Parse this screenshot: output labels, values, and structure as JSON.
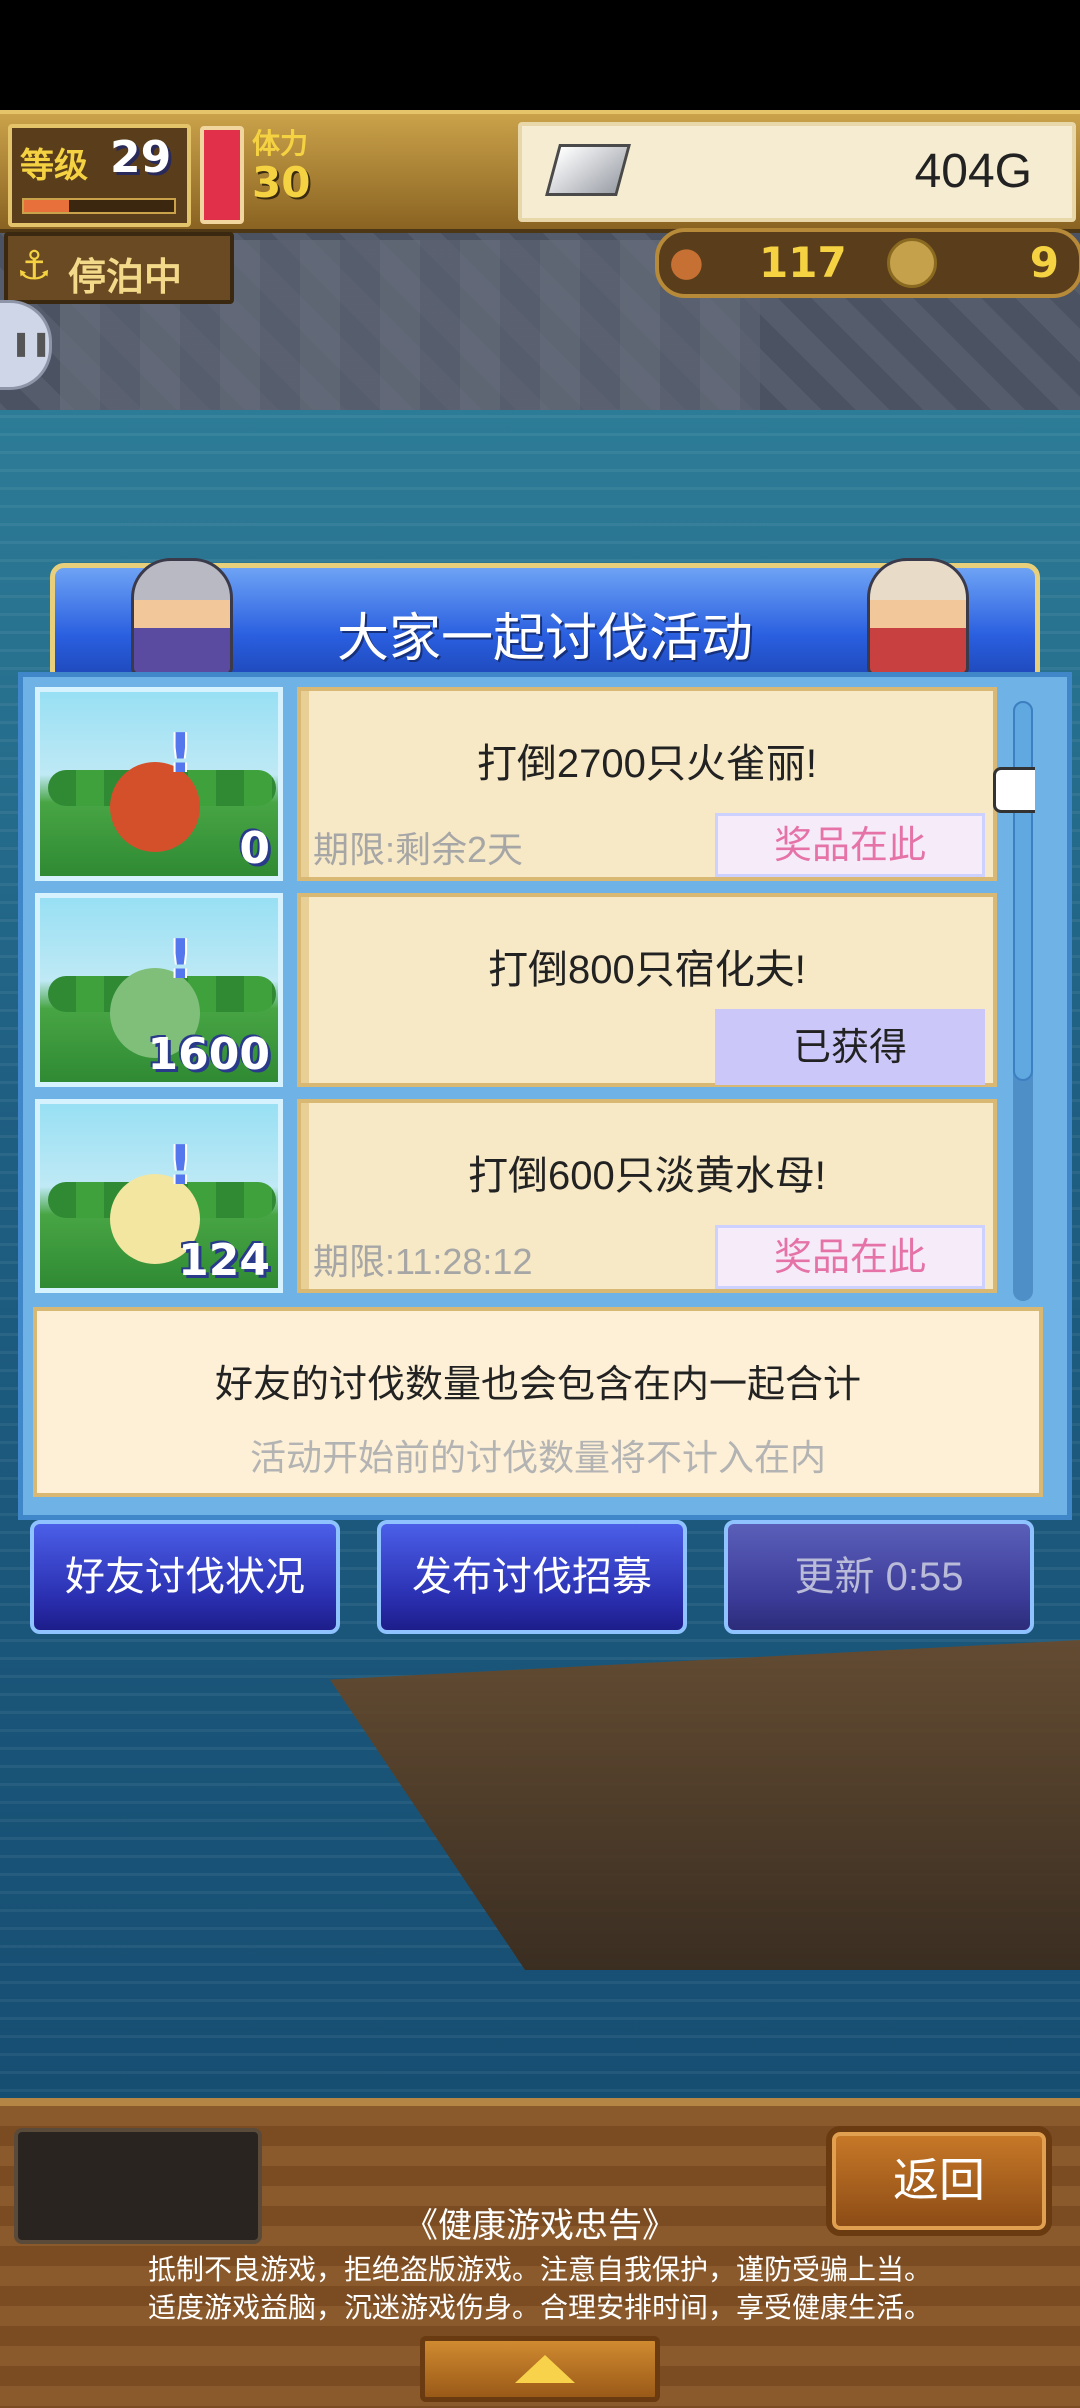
{
  "hud": {
    "level_label": "等级",
    "level": "29",
    "level_progress": 0.3,
    "stamina_label": "体力",
    "stamina": "30",
    "gold": "404G"
  },
  "status": {
    "moored_label": "停泊中",
    "food": "117",
    "coins": "9"
  },
  "panel": {
    "title": "大家一起讨伐活动",
    "quests": [
      {
        "title": "打倒2700只火雀丽!",
        "time": "期限:剩余2天",
        "button": "奖品在此",
        "button_state": "prize",
        "count": "0"
      },
      {
        "title": "打倒800只宿化夫!",
        "time": "",
        "button": "已获得",
        "button_state": "obtained",
        "count": "1600"
      },
      {
        "title": "打倒600只淡黄水母!",
        "time": "期限:11:28:12",
        "button": "奖品在此",
        "button_state": "prize",
        "count": "124"
      }
    ],
    "info_main": "好友的讨伐数量也会包含在内一起合计",
    "info_sub": "活动开始前的讨伐数量将不计入在内"
  },
  "actions": {
    "friend_status": "好友讨伐状况",
    "post_recruit": "发布讨伐招募",
    "refresh": "更新 0:55"
  },
  "bottom": {
    "back": "返回",
    "notice_title": "《健康游戏忠告》",
    "notice_line1": "抵制不良游戏，拒绝盗版游戏。注意自我保护，谨防受骗上当。",
    "notice_line2": "适度游戏益脑，沉迷游戏伤身。合理安排时间，享受健康生活。"
  },
  "colors": {
    "title_bar": "#2a5fe0",
    "card_bg": "#f7e9c6",
    "prize_text": "#e573a8",
    "obtained_bg": "#cbc8f9",
    "button_blue": "#2a2fb0"
  }
}
